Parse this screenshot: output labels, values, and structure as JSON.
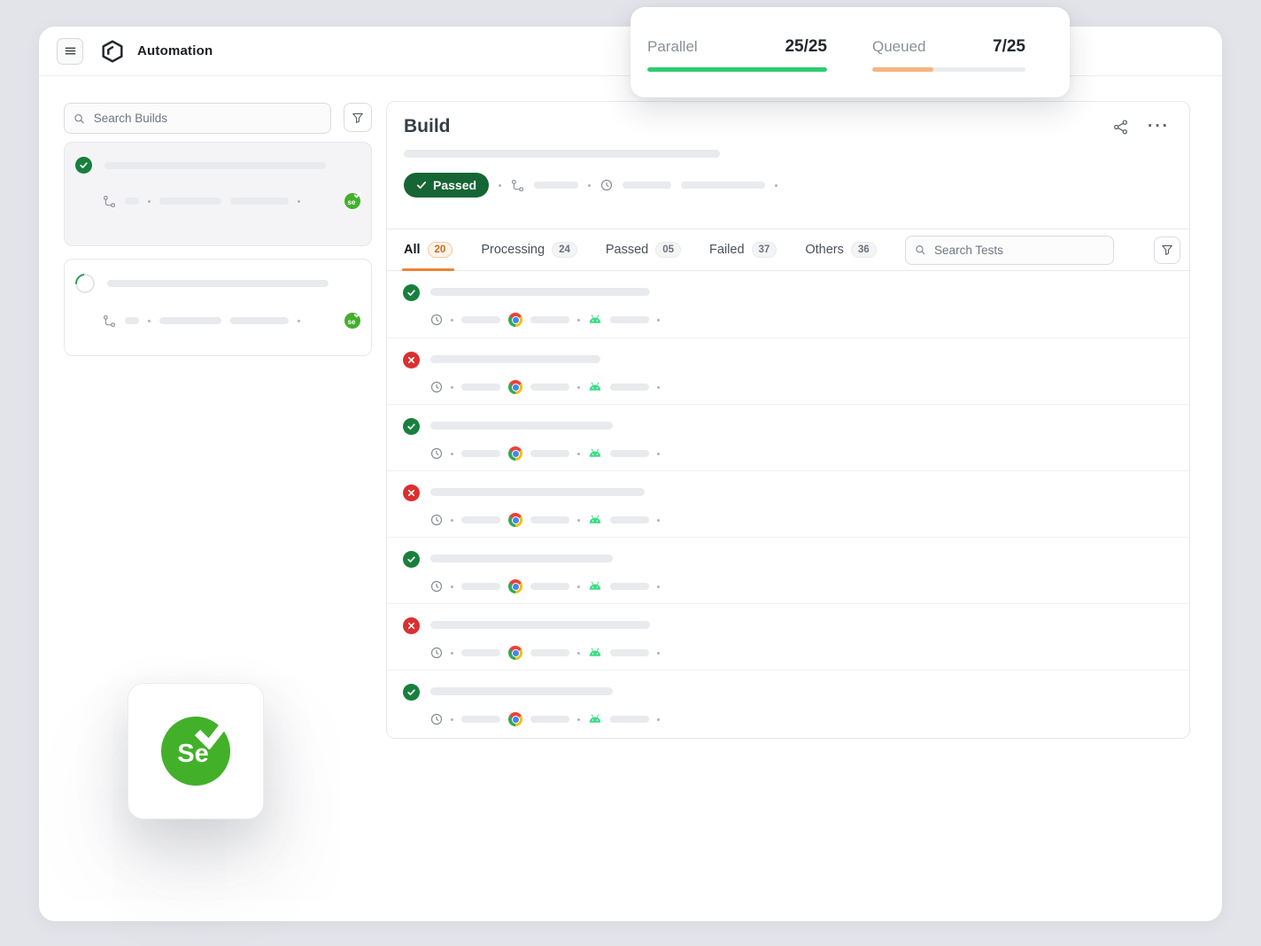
{
  "header": {
    "app_title": "Automation"
  },
  "overlay": {
    "parallel": {
      "label": "Parallel",
      "value": "25/25",
      "percent": 100
    },
    "queued": {
      "label": "Queued",
      "value": "7/25",
      "percent": 40
    }
  },
  "sidebar": {
    "search_placeholder": "Search Builds",
    "builds": [
      {
        "status": "passed",
        "selected": true
      },
      {
        "status": "running",
        "selected": false
      }
    ]
  },
  "main": {
    "title": "Build",
    "status_badge": "Passed",
    "tabs": [
      {
        "label": "All",
        "count": "20",
        "active": true
      },
      {
        "label": "Processing",
        "count": "24",
        "active": false
      },
      {
        "label": "Passed",
        "count": "05",
        "active": false
      },
      {
        "label": "Failed",
        "count": "37",
        "active": false
      },
      {
        "label": "Others",
        "count": "36",
        "active": false
      }
    ],
    "search_placeholder": "Search Tests",
    "tests": [
      {
        "status": "passed"
      },
      {
        "status": "failed"
      },
      {
        "status": "passed"
      },
      {
        "status": "failed"
      },
      {
        "status": "passed"
      },
      {
        "status": "failed"
      },
      {
        "status": "passed"
      }
    ]
  },
  "selenium": {
    "big_label": "Se",
    "small_label": "se"
  },
  "colors": {
    "passed_green": "#17803D",
    "failed_red": "#DC2F2F",
    "badge_green": "#166534",
    "selenium_green": "#43B02A",
    "tab_accent_orange": "#EE8234",
    "progress_green": "#2ECC71",
    "progress_orange": "#F6B480"
  }
}
